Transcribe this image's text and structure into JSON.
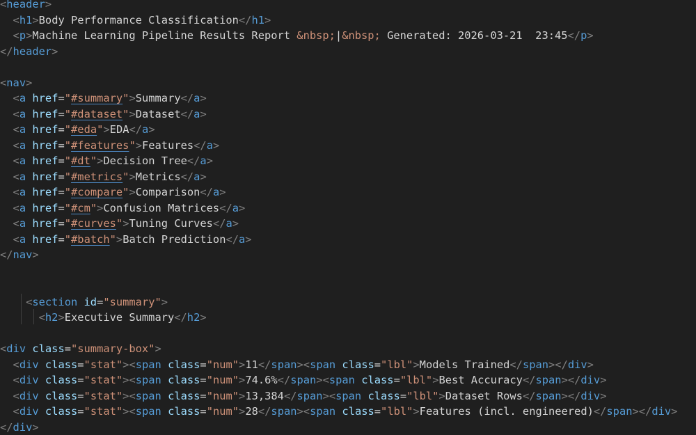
{
  "lines": [
    {
      "indent": "",
      "tokens": [
        [
          "punc",
          "<"
        ],
        [
          "tag",
          "header"
        ],
        [
          "punc",
          ">"
        ]
      ]
    },
    {
      "indent": "  ",
      "tokens": [
        [
          "punc",
          "<"
        ],
        [
          "tag",
          "h1"
        ],
        [
          "punc",
          ">"
        ],
        [
          "text",
          "Body Performance Classification"
        ],
        [
          "punc",
          "</"
        ],
        [
          "tag",
          "h1"
        ],
        [
          "punc",
          ">"
        ]
      ]
    },
    {
      "indent": "  ",
      "tokens": [
        [
          "punc",
          "<"
        ],
        [
          "tag",
          "p"
        ],
        [
          "punc",
          ">"
        ],
        [
          "text",
          "Machine Learning Pipeline Results Report "
        ],
        [
          "ent",
          "&nbsp;"
        ],
        [
          "text",
          "|"
        ],
        [
          "ent",
          "&nbsp;"
        ],
        [
          "text",
          " Generated: 2026-03-21  23:45"
        ],
        [
          "punc",
          "</"
        ],
        [
          "tag",
          "p"
        ],
        [
          "punc",
          ">"
        ]
      ]
    },
    {
      "indent": "",
      "tokens": [
        [
          "punc",
          "</"
        ],
        [
          "tag",
          "header"
        ],
        [
          "punc",
          ">"
        ]
      ]
    },
    {
      "indent": "",
      "tokens": []
    },
    {
      "indent": "",
      "tokens": [
        [
          "punc",
          "<"
        ],
        [
          "tag",
          "nav"
        ],
        [
          "punc",
          ">"
        ]
      ]
    },
    {
      "indent": "  ",
      "tokens": [
        [
          "punc",
          "<"
        ],
        [
          "tag",
          "a"
        ],
        [
          "text",
          " "
        ],
        [
          "attr",
          "href"
        ],
        [
          "text",
          "="
        ],
        [
          "str",
          "\""
        ],
        [
          "link",
          "#summary"
        ],
        [
          "str",
          "\""
        ],
        [
          "punc",
          ">"
        ],
        [
          "text",
          "Summary"
        ],
        [
          "punc",
          "</"
        ],
        [
          "tag",
          "a"
        ],
        [
          "punc",
          ">"
        ]
      ]
    },
    {
      "indent": "  ",
      "tokens": [
        [
          "punc",
          "<"
        ],
        [
          "tag",
          "a"
        ],
        [
          "text",
          " "
        ],
        [
          "attr",
          "href"
        ],
        [
          "text",
          "="
        ],
        [
          "str",
          "\""
        ],
        [
          "link",
          "#dataset"
        ],
        [
          "str",
          "\""
        ],
        [
          "punc",
          ">"
        ],
        [
          "text",
          "Dataset"
        ],
        [
          "punc",
          "</"
        ],
        [
          "tag",
          "a"
        ],
        [
          "punc",
          ">"
        ]
      ]
    },
    {
      "indent": "  ",
      "tokens": [
        [
          "punc",
          "<"
        ],
        [
          "tag",
          "a"
        ],
        [
          "text",
          " "
        ],
        [
          "attr",
          "href"
        ],
        [
          "text",
          "="
        ],
        [
          "str",
          "\""
        ],
        [
          "link",
          "#eda"
        ],
        [
          "str",
          "\""
        ],
        [
          "punc",
          ">"
        ],
        [
          "text",
          "EDA"
        ],
        [
          "punc",
          "</"
        ],
        [
          "tag",
          "a"
        ],
        [
          "punc",
          ">"
        ]
      ]
    },
    {
      "indent": "  ",
      "tokens": [
        [
          "punc",
          "<"
        ],
        [
          "tag",
          "a"
        ],
        [
          "text",
          " "
        ],
        [
          "attr",
          "href"
        ],
        [
          "text",
          "="
        ],
        [
          "str",
          "\""
        ],
        [
          "link",
          "#features"
        ],
        [
          "str",
          "\""
        ],
        [
          "punc",
          ">"
        ],
        [
          "text",
          "Features"
        ],
        [
          "punc",
          "</"
        ],
        [
          "tag",
          "a"
        ],
        [
          "punc",
          ">"
        ]
      ]
    },
    {
      "indent": "  ",
      "tokens": [
        [
          "punc",
          "<"
        ],
        [
          "tag",
          "a"
        ],
        [
          "text",
          " "
        ],
        [
          "attr",
          "href"
        ],
        [
          "text",
          "="
        ],
        [
          "str",
          "\""
        ],
        [
          "link",
          "#dt"
        ],
        [
          "str",
          "\""
        ],
        [
          "punc",
          ">"
        ],
        [
          "text",
          "Decision Tree"
        ],
        [
          "punc",
          "</"
        ],
        [
          "tag",
          "a"
        ],
        [
          "punc",
          ">"
        ]
      ]
    },
    {
      "indent": "  ",
      "tokens": [
        [
          "punc",
          "<"
        ],
        [
          "tag",
          "a"
        ],
        [
          "text",
          " "
        ],
        [
          "attr",
          "href"
        ],
        [
          "text",
          "="
        ],
        [
          "str",
          "\""
        ],
        [
          "link",
          "#metrics"
        ],
        [
          "str",
          "\""
        ],
        [
          "punc",
          ">"
        ],
        [
          "text",
          "Metrics"
        ],
        [
          "punc",
          "</"
        ],
        [
          "tag",
          "a"
        ],
        [
          "punc",
          ">"
        ]
      ]
    },
    {
      "indent": "  ",
      "tokens": [
        [
          "punc",
          "<"
        ],
        [
          "tag",
          "a"
        ],
        [
          "text",
          " "
        ],
        [
          "attr",
          "href"
        ],
        [
          "text",
          "="
        ],
        [
          "str",
          "\""
        ],
        [
          "link",
          "#compare"
        ],
        [
          "str",
          "\""
        ],
        [
          "punc",
          ">"
        ],
        [
          "text",
          "Comparison"
        ],
        [
          "punc",
          "</"
        ],
        [
          "tag",
          "a"
        ],
        [
          "punc",
          ">"
        ]
      ]
    },
    {
      "indent": "  ",
      "tokens": [
        [
          "punc",
          "<"
        ],
        [
          "tag",
          "a"
        ],
        [
          "text",
          " "
        ],
        [
          "attr",
          "href"
        ],
        [
          "text",
          "="
        ],
        [
          "str",
          "\""
        ],
        [
          "link",
          "#cm"
        ],
        [
          "str",
          "\""
        ],
        [
          "punc",
          ">"
        ],
        [
          "text",
          "Confusion Matrices"
        ],
        [
          "punc",
          "</"
        ],
        [
          "tag",
          "a"
        ],
        [
          "punc",
          ">"
        ]
      ]
    },
    {
      "indent": "  ",
      "tokens": [
        [
          "punc",
          "<"
        ],
        [
          "tag",
          "a"
        ],
        [
          "text",
          " "
        ],
        [
          "attr",
          "href"
        ],
        [
          "text",
          "="
        ],
        [
          "str",
          "\""
        ],
        [
          "link",
          "#curves"
        ],
        [
          "str",
          "\""
        ],
        [
          "punc",
          ">"
        ],
        [
          "text",
          "Tuning Curves"
        ],
        [
          "punc",
          "</"
        ],
        [
          "tag",
          "a"
        ],
        [
          "punc",
          ">"
        ]
      ]
    },
    {
      "indent": "  ",
      "tokens": [
        [
          "punc",
          "<"
        ],
        [
          "tag",
          "a"
        ],
        [
          "text",
          " "
        ],
        [
          "attr",
          "href"
        ],
        [
          "text",
          "="
        ],
        [
          "str",
          "\""
        ],
        [
          "link",
          "#batch"
        ],
        [
          "str",
          "\""
        ],
        [
          "punc",
          ">"
        ],
        [
          "text",
          "Batch Prediction"
        ],
        [
          "punc",
          "</"
        ],
        [
          "tag",
          "a"
        ],
        [
          "punc",
          ">"
        ]
      ]
    },
    {
      "indent": "",
      "tokens": [
        [
          "punc",
          "</"
        ],
        [
          "tag",
          "nav"
        ],
        [
          "punc",
          ">"
        ]
      ]
    },
    {
      "indent": "",
      "tokens": []
    },
    {
      "indent": "",
      "tokens": []
    },
    {
      "indent": "    ",
      "tokens": [
        [
          "punc",
          "<"
        ],
        [
          "tag",
          "section"
        ],
        [
          "text",
          " "
        ],
        [
          "attr",
          "id"
        ],
        [
          "text",
          "="
        ],
        [
          "str",
          "\"summary\""
        ],
        [
          "punc",
          ">"
        ]
      ]
    },
    {
      "indent": "      ",
      "tokens": [
        [
          "punc",
          "<"
        ],
        [
          "tag",
          "h2"
        ],
        [
          "punc",
          ">"
        ],
        [
          "text",
          "Executive Summary"
        ],
        [
          "punc",
          "</"
        ],
        [
          "tag",
          "h2"
        ],
        [
          "punc",
          ">"
        ]
      ]
    },
    {
      "indent": "",
      "tokens": []
    },
    {
      "indent": "",
      "tokens": [
        [
          "punc",
          "<"
        ],
        [
          "tag",
          "div"
        ],
        [
          "text",
          " "
        ],
        [
          "attr",
          "class"
        ],
        [
          "text",
          "="
        ],
        [
          "str",
          "\"summary-box\""
        ],
        [
          "punc",
          ">"
        ]
      ]
    },
    {
      "indent": "  ",
      "tokens": [
        [
          "punc",
          "<"
        ],
        [
          "tag",
          "div"
        ],
        [
          "text",
          " "
        ],
        [
          "attr",
          "class"
        ],
        [
          "text",
          "="
        ],
        [
          "str",
          "\"stat\""
        ],
        [
          "punc",
          ">"
        ],
        [
          "punc",
          "<"
        ],
        [
          "tag",
          "span"
        ],
        [
          "text",
          " "
        ],
        [
          "attr",
          "class"
        ],
        [
          "text",
          "="
        ],
        [
          "str",
          "\"num\""
        ],
        [
          "punc",
          ">"
        ],
        [
          "text",
          "11"
        ],
        [
          "punc",
          "</"
        ],
        [
          "tag",
          "span"
        ],
        [
          "punc",
          ">"
        ],
        [
          "punc",
          "<"
        ],
        [
          "tag",
          "span"
        ],
        [
          "text",
          " "
        ],
        [
          "attr",
          "class"
        ],
        [
          "text",
          "="
        ],
        [
          "str",
          "\"lbl\""
        ],
        [
          "punc",
          ">"
        ],
        [
          "text",
          "Models Trained"
        ],
        [
          "punc",
          "</"
        ],
        [
          "tag",
          "span"
        ],
        [
          "punc",
          ">"
        ],
        [
          "punc",
          "</"
        ],
        [
          "tag",
          "div"
        ],
        [
          "punc",
          ">"
        ]
      ]
    },
    {
      "indent": "  ",
      "tokens": [
        [
          "punc",
          "<"
        ],
        [
          "tag",
          "div"
        ],
        [
          "text",
          " "
        ],
        [
          "attr",
          "class"
        ],
        [
          "text",
          "="
        ],
        [
          "str",
          "\"stat\""
        ],
        [
          "punc",
          ">"
        ],
        [
          "punc",
          "<"
        ],
        [
          "tag",
          "span"
        ],
        [
          "text",
          " "
        ],
        [
          "attr",
          "class"
        ],
        [
          "text",
          "="
        ],
        [
          "str",
          "\"num\""
        ],
        [
          "punc",
          ">"
        ],
        [
          "text",
          "74.6%"
        ],
        [
          "punc",
          "</"
        ],
        [
          "tag",
          "span"
        ],
        [
          "punc",
          ">"
        ],
        [
          "punc",
          "<"
        ],
        [
          "tag",
          "span"
        ],
        [
          "text",
          " "
        ],
        [
          "attr",
          "class"
        ],
        [
          "text",
          "="
        ],
        [
          "str",
          "\"lbl\""
        ],
        [
          "punc",
          ">"
        ],
        [
          "text",
          "Best Accuracy"
        ],
        [
          "punc",
          "</"
        ],
        [
          "tag",
          "span"
        ],
        [
          "punc",
          ">"
        ],
        [
          "punc",
          "</"
        ],
        [
          "tag",
          "div"
        ],
        [
          "punc",
          ">"
        ]
      ]
    },
    {
      "indent": "  ",
      "tokens": [
        [
          "punc",
          "<"
        ],
        [
          "tag",
          "div"
        ],
        [
          "text",
          " "
        ],
        [
          "attr",
          "class"
        ],
        [
          "text",
          "="
        ],
        [
          "str",
          "\"stat\""
        ],
        [
          "punc",
          ">"
        ],
        [
          "punc",
          "<"
        ],
        [
          "tag",
          "span"
        ],
        [
          "text",
          " "
        ],
        [
          "attr",
          "class"
        ],
        [
          "text",
          "="
        ],
        [
          "str",
          "\"num\""
        ],
        [
          "punc",
          ">"
        ],
        [
          "text",
          "13,384"
        ],
        [
          "punc",
          "</"
        ],
        [
          "tag",
          "span"
        ],
        [
          "punc",
          ">"
        ],
        [
          "punc",
          "<"
        ],
        [
          "tag",
          "span"
        ],
        [
          "text",
          " "
        ],
        [
          "attr",
          "class"
        ],
        [
          "text",
          "="
        ],
        [
          "str",
          "\"lbl\""
        ],
        [
          "punc",
          ">"
        ],
        [
          "text",
          "Dataset Rows"
        ],
        [
          "punc",
          "</"
        ],
        [
          "tag",
          "span"
        ],
        [
          "punc",
          ">"
        ],
        [
          "punc",
          "</"
        ],
        [
          "tag",
          "div"
        ],
        [
          "punc",
          ">"
        ]
      ]
    },
    {
      "indent": "  ",
      "tokens": [
        [
          "punc",
          "<"
        ],
        [
          "tag",
          "div"
        ],
        [
          "text",
          " "
        ],
        [
          "attr",
          "class"
        ],
        [
          "text",
          "="
        ],
        [
          "str",
          "\"stat\""
        ],
        [
          "punc",
          ">"
        ],
        [
          "punc",
          "<"
        ],
        [
          "tag",
          "span"
        ],
        [
          "text",
          " "
        ],
        [
          "attr",
          "class"
        ],
        [
          "text",
          "="
        ],
        [
          "str",
          "\"num\""
        ],
        [
          "punc",
          ">"
        ],
        [
          "text",
          "28"
        ],
        [
          "punc",
          "</"
        ],
        [
          "tag",
          "span"
        ],
        [
          "punc",
          ">"
        ],
        [
          "punc",
          "<"
        ],
        [
          "tag",
          "span"
        ],
        [
          "text",
          " "
        ],
        [
          "attr",
          "class"
        ],
        [
          "text",
          "="
        ],
        [
          "str",
          "\"lbl\""
        ],
        [
          "punc",
          ">"
        ],
        [
          "text",
          "Features (incl. engineered)"
        ],
        [
          "punc",
          "</"
        ],
        [
          "tag",
          "span"
        ],
        [
          "punc",
          ">"
        ],
        [
          "punc",
          "</"
        ],
        [
          "tag",
          "div"
        ],
        [
          "punc",
          ">"
        ]
      ]
    },
    {
      "indent": "",
      "tokens": [
        [
          "punc",
          "</"
        ],
        [
          "tag",
          "div"
        ],
        [
          "punc",
          ">"
        ]
      ]
    }
  ],
  "colors": {
    "background": "#1f1f1f",
    "tag": "#569cd6",
    "punctuation": "#808080",
    "attribute": "#9cdcfe",
    "string": "#ce9178",
    "text": "#d4d4d4",
    "indent_guide": "#404040"
  }
}
